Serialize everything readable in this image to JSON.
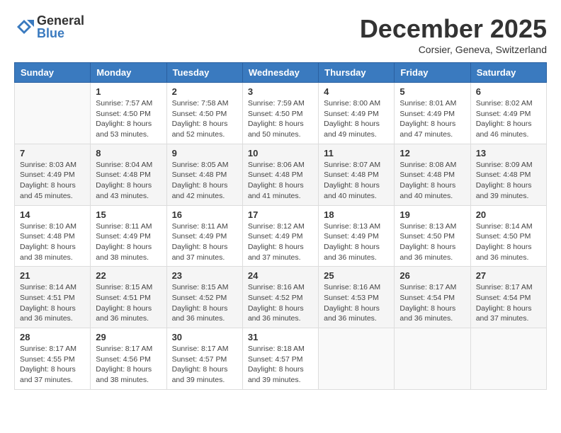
{
  "logo": {
    "general": "General",
    "blue": "Blue"
  },
  "header": {
    "month": "December 2025",
    "location": "Corsier, Geneva, Switzerland"
  },
  "weekdays": [
    "Sunday",
    "Monday",
    "Tuesday",
    "Wednesday",
    "Thursday",
    "Friday",
    "Saturday"
  ],
  "weeks": [
    [
      {
        "day": "",
        "sunrise": "",
        "sunset": "",
        "daylight": ""
      },
      {
        "day": "1",
        "sunrise": "Sunrise: 7:57 AM",
        "sunset": "Sunset: 4:50 PM",
        "daylight": "Daylight: 8 hours and 53 minutes."
      },
      {
        "day": "2",
        "sunrise": "Sunrise: 7:58 AM",
        "sunset": "Sunset: 4:50 PM",
        "daylight": "Daylight: 8 hours and 52 minutes."
      },
      {
        "day": "3",
        "sunrise": "Sunrise: 7:59 AM",
        "sunset": "Sunset: 4:50 PM",
        "daylight": "Daylight: 8 hours and 50 minutes."
      },
      {
        "day": "4",
        "sunrise": "Sunrise: 8:00 AM",
        "sunset": "Sunset: 4:49 PM",
        "daylight": "Daylight: 8 hours and 49 minutes."
      },
      {
        "day": "5",
        "sunrise": "Sunrise: 8:01 AM",
        "sunset": "Sunset: 4:49 PM",
        "daylight": "Daylight: 8 hours and 47 minutes."
      },
      {
        "day": "6",
        "sunrise": "Sunrise: 8:02 AM",
        "sunset": "Sunset: 4:49 PM",
        "daylight": "Daylight: 8 hours and 46 minutes."
      }
    ],
    [
      {
        "day": "7",
        "sunrise": "Sunrise: 8:03 AM",
        "sunset": "Sunset: 4:49 PM",
        "daylight": "Daylight: 8 hours and 45 minutes."
      },
      {
        "day": "8",
        "sunrise": "Sunrise: 8:04 AM",
        "sunset": "Sunset: 4:48 PM",
        "daylight": "Daylight: 8 hours and 43 minutes."
      },
      {
        "day": "9",
        "sunrise": "Sunrise: 8:05 AM",
        "sunset": "Sunset: 4:48 PM",
        "daylight": "Daylight: 8 hours and 42 minutes."
      },
      {
        "day": "10",
        "sunrise": "Sunrise: 8:06 AM",
        "sunset": "Sunset: 4:48 PM",
        "daylight": "Daylight: 8 hours and 41 minutes."
      },
      {
        "day": "11",
        "sunrise": "Sunrise: 8:07 AM",
        "sunset": "Sunset: 4:48 PM",
        "daylight": "Daylight: 8 hours and 40 minutes."
      },
      {
        "day": "12",
        "sunrise": "Sunrise: 8:08 AM",
        "sunset": "Sunset: 4:48 PM",
        "daylight": "Daylight: 8 hours and 40 minutes."
      },
      {
        "day": "13",
        "sunrise": "Sunrise: 8:09 AM",
        "sunset": "Sunset: 4:48 PM",
        "daylight": "Daylight: 8 hours and 39 minutes."
      }
    ],
    [
      {
        "day": "14",
        "sunrise": "Sunrise: 8:10 AM",
        "sunset": "Sunset: 4:48 PM",
        "daylight": "Daylight: 8 hours and 38 minutes."
      },
      {
        "day": "15",
        "sunrise": "Sunrise: 8:11 AM",
        "sunset": "Sunset: 4:49 PM",
        "daylight": "Daylight: 8 hours and 38 minutes."
      },
      {
        "day": "16",
        "sunrise": "Sunrise: 8:11 AM",
        "sunset": "Sunset: 4:49 PM",
        "daylight": "Daylight: 8 hours and 37 minutes."
      },
      {
        "day": "17",
        "sunrise": "Sunrise: 8:12 AM",
        "sunset": "Sunset: 4:49 PM",
        "daylight": "Daylight: 8 hours and 37 minutes."
      },
      {
        "day": "18",
        "sunrise": "Sunrise: 8:13 AM",
        "sunset": "Sunset: 4:49 PM",
        "daylight": "Daylight: 8 hours and 36 minutes."
      },
      {
        "day": "19",
        "sunrise": "Sunrise: 8:13 AM",
        "sunset": "Sunset: 4:50 PM",
        "daylight": "Daylight: 8 hours and 36 minutes."
      },
      {
        "day": "20",
        "sunrise": "Sunrise: 8:14 AM",
        "sunset": "Sunset: 4:50 PM",
        "daylight": "Daylight: 8 hours and 36 minutes."
      }
    ],
    [
      {
        "day": "21",
        "sunrise": "Sunrise: 8:14 AM",
        "sunset": "Sunset: 4:51 PM",
        "daylight": "Daylight: 8 hours and 36 minutes."
      },
      {
        "day": "22",
        "sunrise": "Sunrise: 8:15 AM",
        "sunset": "Sunset: 4:51 PM",
        "daylight": "Daylight: 8 hours and 36 minutes."
      },
      {
        "day": "23",
        "sunrise": "Sunrise: 8:15 AM",
        "sunset": "Sunset: 4:52 PM",
        "daylight": "Daylight: 8 hours and 36 minutes."
      },
      {
        "day": "24",
        "sunrise": "Sunrise: 8:16 AM",
        "sunset": "Sunset: 4:52 PM",
        "daylight": "Daylight: 8 hours and 36 minutes."
      },
      {
        "day": "25",
        "sunrise": "Sunrise: 8:16 AM",
        "sunset": "Sunset: 4:53 PM",
        "daylight": "Daylight: 8 hours and 36 minutes."
      },
      {
        "day": "26",
        "sunrise": "Sunrise: 8:17 AM",
        "sunset": "Sunset: 4:54 PM",
        "daylight": "Daylight: 8 hours and 36 minutes."
      },
      {
        "day": "27",
        "sunrise": "Sunrise: 8:17 AM",
        "sunset": "Sunset: 4:54 PM",
        "daylight": "Daylight: 8 hours and 37 minutes."
      }
    ],
    [
      {
        "day": "28",
        "sunrise": "Sunrise: 8:17 AM",
        "sunset": "Sunset: 4:55 PM",
        "daylight": "Daylight: 8 hours and 37 minutes."
      },
      {
        "day": "29",
        "sunrise": "Sunrise: 8:17 AM",
        "sunset": "Sunset: 4:56 PM",
        "daylight": "Daylight: 8 hours and 38 minutes."
      },
      {
        "day": "30",
        "sunrise": "Sunrise: 8:17 AM",
        "sunset": "Sunset: 4:57 PM",
        "daylight": "Daylight: 8 hours and 39 minutes."
      },
      {
        "day": "31",
        "sunrise": "Sunrise: 8:18 AM",
        "sunset": "Sunset: 4:57 PM",
        "daylight": "Daylight: 8 hours and 39 minutes."
      },
      {
        "day": "",
        "sunrise": "",
        "sunset": "",
        "daylight": ""
      },
      {
        "day": "",
        "sunrise": "",
        "sunset": "",
        "daylight": ""
      },
      {
        "day": "",
        "sunrise": "",
        "sunset": "",
        "daylight": ""
      }
    ]
  ]
}
